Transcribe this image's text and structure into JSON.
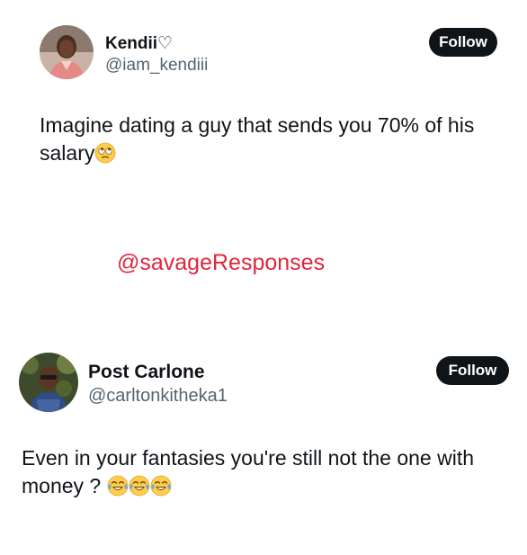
{
  "tweet1": {
    "name": "Kendii♡",
    "handle": "@iam_kendiii",
    "follow_label": "Follow",
    "text": "Imagine dating a guy that sends you 70% of his salary",
    "emoji": "face-with-rolling-eyes"
  },
  "watermark": "@savageResponses",
  "tweet2": {
    "name": "Post Carlone",
    "handle": "@carltonkitheka1",
    "follow_label": "Follow",
    "text": "Even in your fantasies you're still not the one with money ?",
    "emojis": [
      "face-with-tears-of-joy",
      "face-with-tears-of-joy",
      "face-with-tears-of-joy"
    ]
  },
  "colors": {
    "follow_bg": "#0f1419",
    "handle": "#536471",
    "watermark": "#e0263b"
  }
}
